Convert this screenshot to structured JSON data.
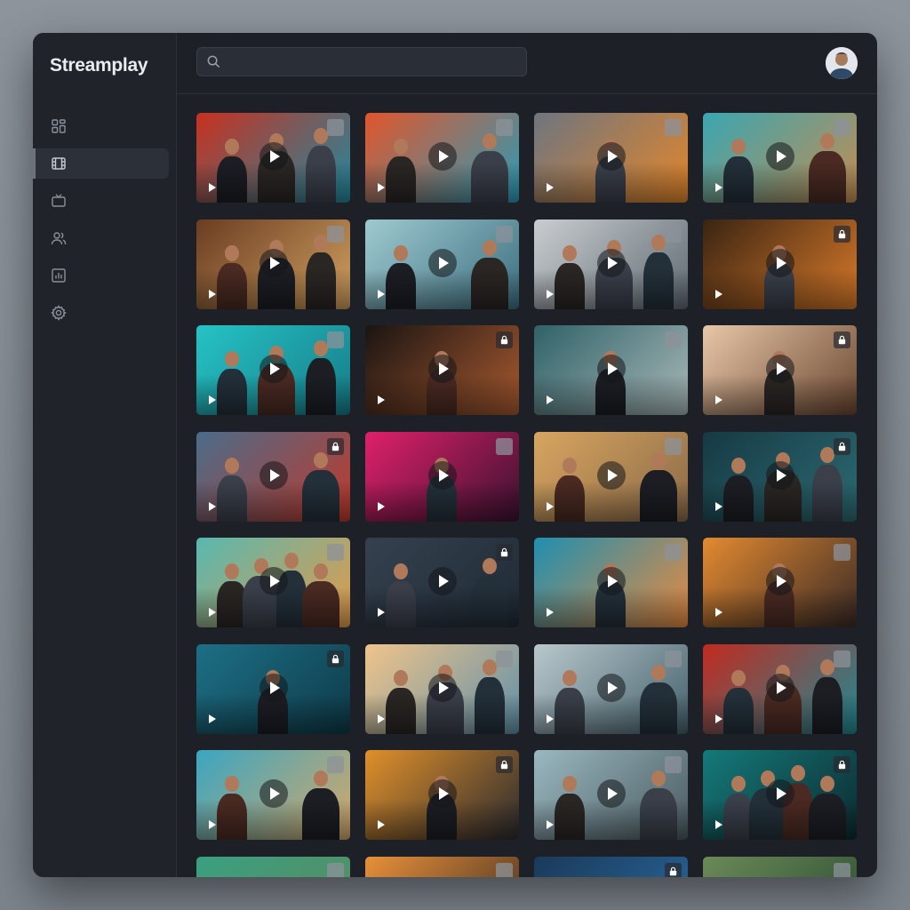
{
  "app": {
    "name": "Streamplay"
  },
  "search": {
    "value": "",
    "placeholder": ""
  },
  "sidebar": {
    "items": [
      {
        "id": "dashboard",
        "icon": "grid-icon",
        "active": false
      },
      {
        "id": "movies",
        "icon": "film-icon",
        "active": true
      },
      {
        "id": "tv",
        "icon": "tv-icon",
        "active": false
      },
      {
        "id": "users",
        "icon": "users-icon",
        "active": false
      },
      {
        "id": "stats",
        "icon": "chart-icon",
        "active": false
      },
      {
        "id": "settings",
        "icon": "gear-icon",
        "active": false
      }
    ]
  },
  "colors": {
    "accent": "#6c7380",
    "background": "#1d2027",
    "sidebar": "#20232a"
  },
  "grid": {
    "columns": 4,
    "cards": [
      {
        "badge": "checkbox",
        "palette": [
          "#c9301f",
          "#1f8aa0"
        ],
        "figures": 3
      },
      {
        "badge": "checkbox",
        "palette": [
          "#e2552b",
          "#2a9cb8"
        ],
        "figures": 2
      },
      {
        "badge": "checkbox",
        "palette": [
          "#6e7580",
          "#e4862a"
        ],
        "figures": 1
      },
      {
        "badge": "checkbox",
        "palette": [
          "#3aa6b2",
          "#c28d52"
        ],
        "figures": 2
      },
      {
        "badge": "checkbox",
        "palette": [
          "#6b3d22",
          "#d0a060"
        ],
        "figures": 3
      },
      {
        "badge": "checkbox",
        "palette": [
          "#9ec9cf",
          "#3d6f80"
        ],
        "figures": 2
      },
      {
        "badge": "checkbox",
        "palette": [
          "#c9cdd0",
          "#5f6a72"
        ],
        "figures": 3
      },
      {
        "badge": "lock",
        "palette": [
          "#3a2412",
          "#d97a2a"
        ],
        "figures": 1
      },
      {
        "badge": "checkbox",
        "palette": [
          "#25c3c5",
          "#177c88"
        ],
        "figures": 3
      },
      {
        "badge": "lock",
        "palette": [
          "#1a1412",
          "#a85a30"
        ],
        "figures": 1
      },
      {
        "badge": "checkbox",
        "palette": [
          "#2f6268",
          "#a9b8b8"
        ],
        "figures": 1
      },
      {
        "badge": "lock",
        "palette": [
          "#e7c7a8",
          "#6a4630"
        ],
        "figures": 1
      },
      {
        "badge": "lock",
        "palette": [
          "#4a6c8a",
          "#c0392b"
        ],
        "figures": 2
      },
      {
        "badge": "checkbox",
        "palette": [
          "#e0206a",
          "#3a1230"
        ],
        "figures": 1
      },
      {
        "badge": "checkbox",
        "palette": [
          "#d8a560",
          "#8a6a48"
        ],
        "figures": 2
      },
      {
        "badge": "lock",
        "palette": [
          "#163a44",
          "#2d6a72"
        ],
        "figures": 3
      },
      {
        "badge": "checkbox",
        "palette": [
          "#58b8b0",
          "#e29a4a"
        ],
        "figures": 4
      },
      {
        "badge": "lock",
        "palette": [
          "#35414e",
          "#1f2a36"
        ],
        "figures": 2
      },
      {
        "badge": "checkbox",
        "palette": [
          "#1f8fb0",
          "#e88a40"
        ],
        "figures": 1
      },
      {
        "badge": "checkbox",
        "palette": [
          "#e38a30",
          "#3a2a26"
        ],
        "figures": 1
      },
      {
        "badge": "lock",
        "palette": [
          "#1d6f86",
          "#0e3a48"
        ],
        "figures": 1
      },
      {
        "badge": "checkbox",
        "palette": [
          "#f0c48a",
          "#5f8fa8"
        ],
        "figures": 3
      },
      {
        "badge": "checkbox",
        "palette": [
          "#b8c8cc",
          "#44606c"
        ],
        "figures": 2
      },
      {
        "badge": "checkbox",
        "palette": [
          "#c22a1f",
          "#1f8a94"
        ],
        "figures": 3
      },
      {
        "badge": "checkbox",
        "palette": [
          "#3aa6c2",
          "#d6a868"
        ],
        "figures": 2
      },
      {
        "badge": "lock",
        "palette": [
          "#e0902a",
          "#2a2a30"
        ],
        "figures": 1
      },
      {
        "badge": "checkbox",
        "palette": [
          "#9ab8c0",
          "#4a5a60"
        ],
        "figures": 2
      },
      {
        "badge": "lock",
        "palette": [
          "#157a7a",
          "#0c2a30"
        ],
        "figures": 4
      },
      {
        "badge": "checkbox",
        "palette": [
          "#3aa080",
          "#5a8a60"
        ],
        "figures": 0
      },
      {
        "badge": "checkbox",
        "palette": [
          "#e8903a",
          "#3a2a20"
        ],
        "figures": 0
      },
      {
        "badge": "lock",
        "palette": [
          "#1a3a5a",
          "#2a6aa0"
        ],
        "figures": 1
      },
      {
        "badge": "checkbox",
        "palette": [
          "#6a8a58",
          "#2a4a30"
        ],
        "figures": 1
      }
    ]
  }
}
